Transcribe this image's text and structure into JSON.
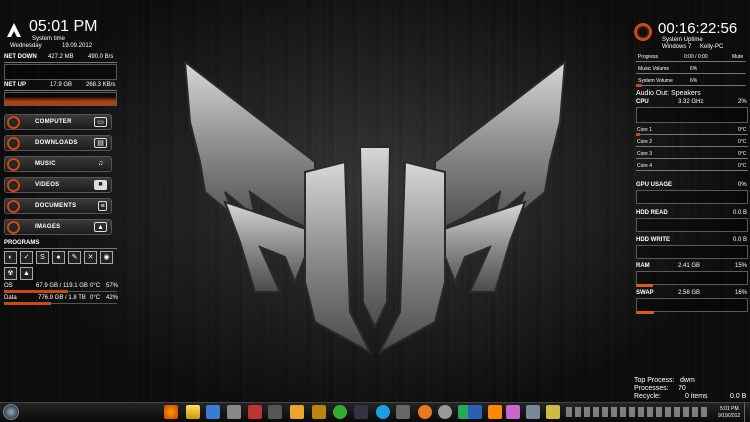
{
  "clock": {
    "time": "05:01 PM",
    "label": "System time",
    "day": "Wednesday",
    "date": "19.09.2012"
  },
  "net_down": {
    "label": "NET DOWN",
    "total": "427.2 MB",
    "rate": "490.0 B/s"
  },
  "net_up": {
    "label": "NET UP",
    "total": "17.9 GB",
    "rate": "268.3 KB/s"
  },
  "shortcuts": [
    {
      "label": "COMPUTER",
      "icon": "computer-icon"
    },
    {
      "label": "DOWNLOADS",
      "icon": "downloads-icon"
    },
    {
      "label": "MUSIC",
      "icon": "headphones-icon"
    },
    {
      "label": "VIDEOS",
      "icon": "camera-icon"
    },
    {
      "label": "DOCUMENTS",
      "icon": "document-icon"
    },
    {
      "label": "IMAGES",
      "icon": "image-icon"
    }
  ],
  "programs": {
    "title": "PROGRAMS"
  },
  "drives": [
    {
      "name": "OS",
      "usage": "67.9 GB / 119.1 GB",
      "temp": "0°C",
      "pct": "57%",
      "fill": 0.57
    },
    {
      "name": "Data",
      "usage": "776.9 GB / 1.8 TB",
      "temp": "0°C",
      "pct": "42%",
      "fill": 0.42
    }
  ],
  "uptime": {
    "value": "00:16:22:56",
    "label": "System Uptime",
    "os": "Windows 7",
    "host": "Kelly-PC"
  },
  "media": {
    "progress_label": "Progress",
    "progress_value": "0:00 / 0:00",
    "mute": "Mute",
    "music_volume_label": "Music Volume",
    "music_volume": "6%",
    "system_volume_label": "System Volume",
    "system_volume": "6%"
  },
  "audio_out": "Audio Out: Speakers",
  "cpu": {
    "label": "CPU",
    "freq": "3.32 GHz",
    "pct": "2%",
    "cores": [
      {
        "label": "Core 1",
        "temp": "0°C"
      },
      {
        "label": "Core 2",
        "temp": "0°C"
      },
      {
        "label": "Core 3",
        "temp": "0°C"
      },
      {
        "label": "Core 4",
        "temp": "0°C"
      }
    ]
  },
  "gpu": {
    "label": "GPU USAGE",
    "pct": "0%"
  },
  "hdd_read": {
    "label": "HDD READ",
    "value": "0.0 B"
  },
  "hdd_write": {
    "label": "HDD WRITE",
    "value": "0.0 B"
  },
  "ram": {
    "label": "RAM",
    "value": "2.41 GB",
    "pct": "15%",
    "fill": 0.15
  },
  "swap": {
    "label": "SWAP",
    "value": "2.56 GB",
    "pct": "16%",
    "fill": 0.16
  },
  "top_process": {
    "label": "Top Process:",
    "value": "dwm"
  },
  "processes": {
    "label": "Processes:",
    "value": "70"
  },
  "recycle": {
    "label": "Recycle:",
    "items": "0 items",
    "size": "0.0 B"
  },
  "taskbar": {
    "time": "5:01 PM",
    "date": "9/19/2012"
  },
  "colors": {
    "accent": "#c94a10",
    "background": "#1e1e1e"
  }
}
